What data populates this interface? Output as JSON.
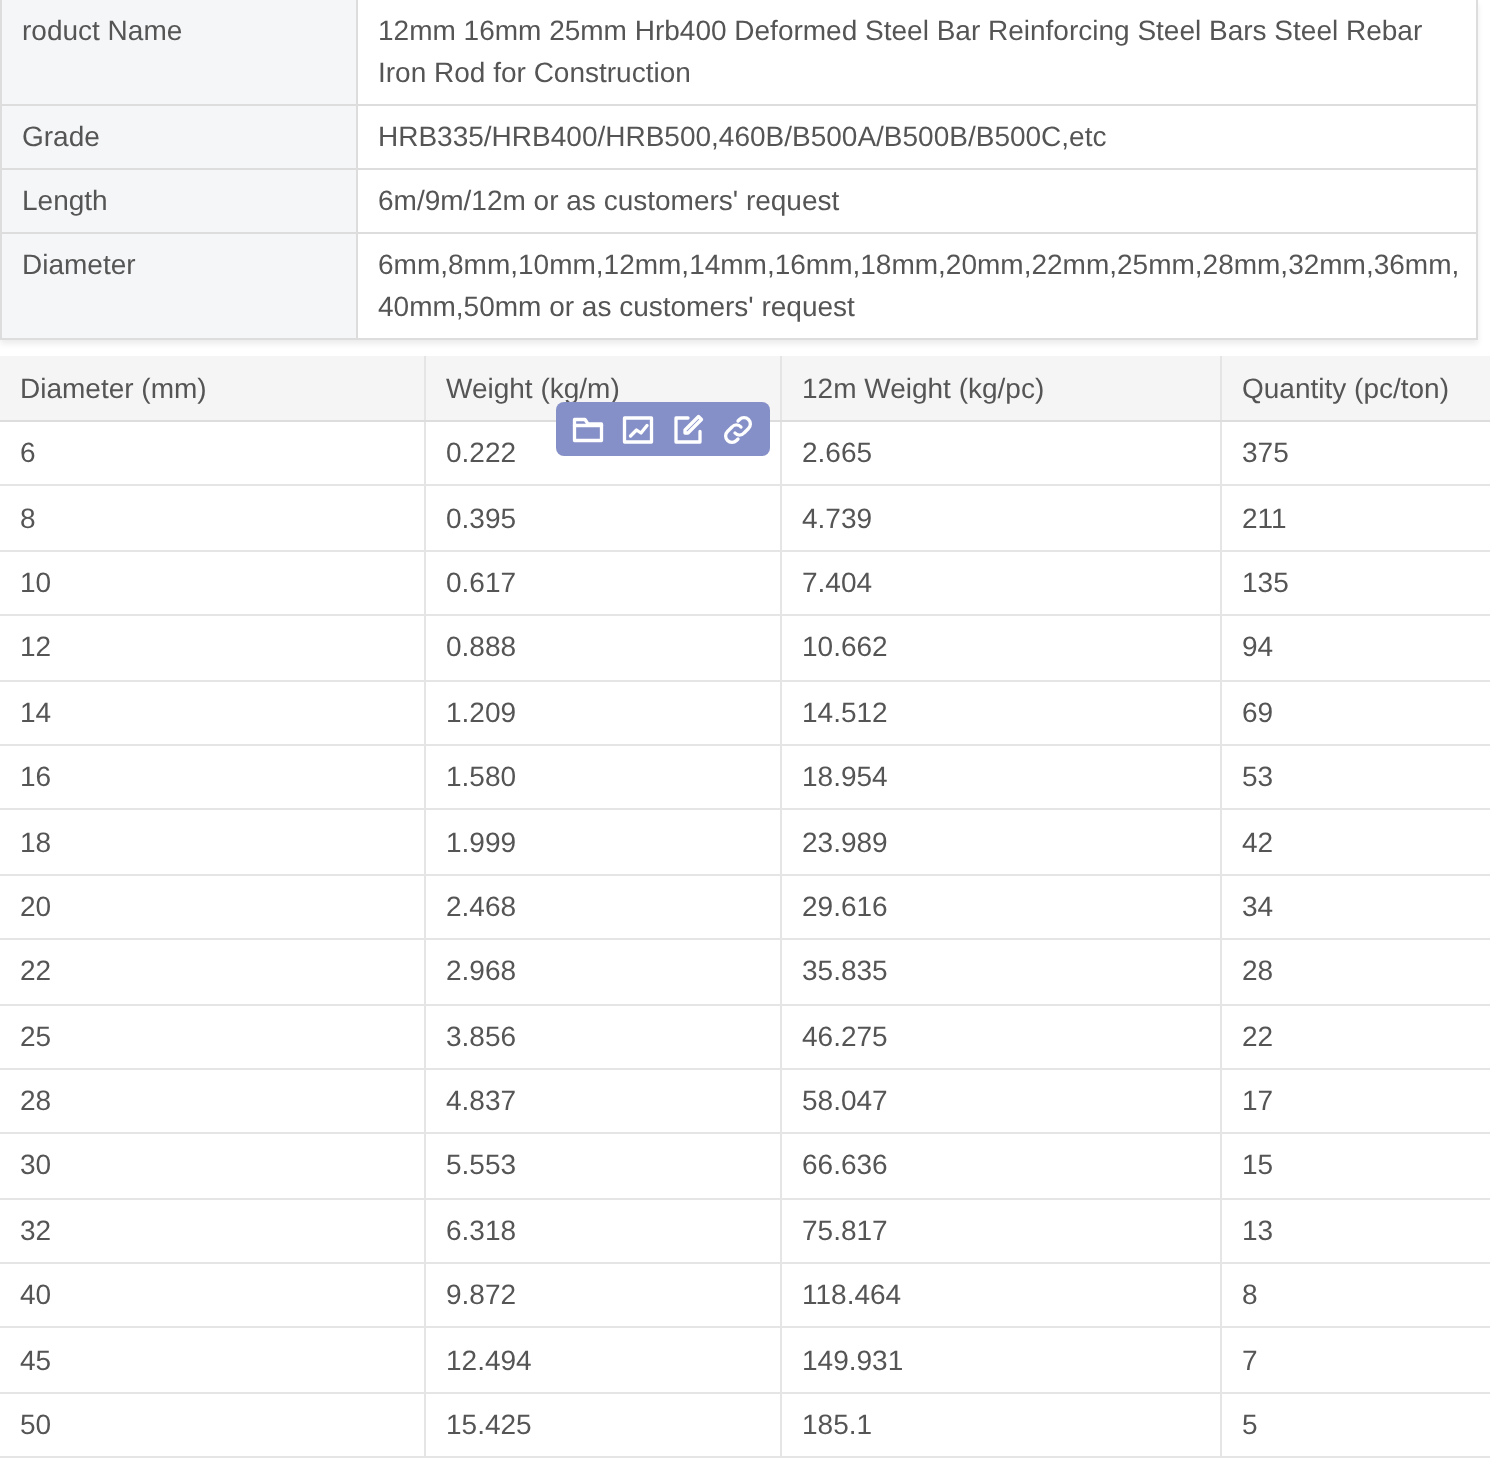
{
  "spec_table": {
    "rows": [
      {
        "label": "roduct Name",
        "value": "12mm 16mm 25mm Hrb400 Deformed Steel Bar Reinforcing Steel Bars Steel Rebar Iron Rod for Construction"
      },
      {
        "label": "Grade",
        "value": "HRB335/HRB400/HRB500,460B/B500A/B500B/B500C,etc"
      },
      {
        "label": "Length",
        "value": "6m/9m/12m or as customers' request"
      },
      {
        "label": "Diameter",
        "value": "6mm,8mm,10mm,12mm,14mm,16mm,18mm,20mm,22mm,25mm,28mm,32mm,36mm, 40mm,50mm or as customers' request"
      }
    ]
  },
  "weight_table": {
    "columns": [
      "Diameter (mm)",
      "Weight (kg/m)",
      "12m Weight (kg/pc)",
      "Quantity (pc/ton)"
    ],
    "rows": [
      [
        "6",
        "0.222",
        "2.665",
        "375"
      ],
      [
        "8",
        "0.395",
        "4.739",
        "211"
      ],
      [
        "10",
        "0.617",
        "7.404",
        "135"
      ],
      [
        "12",
        "0.888",
        "10.662",
        "94"
      ],
      [
        "14",
        "1.209",
        "14.512",
        "69"
      ],
      [
        "16",
        "1.580",
        "18.954",
        "53"
      ],
      [
        "18",
        "1.999",
        "23.989",
        "42"
      ],
      [
        "20",
        "2.468",
        "29.616",
        "34"
      ],
      [
        "22",
        "2.968",
        "35.835",
        "28"
      ],
      [
        "25",
        "3.856",
        "46.275",
        "22"
      ],
      [
        "28",
        "4.837",
        "58.047",
        "17"
      ],
      [
        "30",
        "5.553",
        "66.636",
        "15"
      ],
      [
        "32",
        "6.318",
        "75.817",
        "13"
      ],
      [
        "40",
        "9.872",
        "118.464",
        "8"
      ],
      [
        "45",
        "12.494",
        "149.931",
        "7"
      ],
      [
        "50",
        "15.425",
        "185.1",
        "5"
      ]
    ]
  },
  "floating_toolbar": {
    "buttons": [
      {
        "kind": "folder"
      },
      {
        "kind": "image"
      },
      {
        "kind": "edit"
      },
      {
        "kind": "link"
      }
    ]
  }
}
